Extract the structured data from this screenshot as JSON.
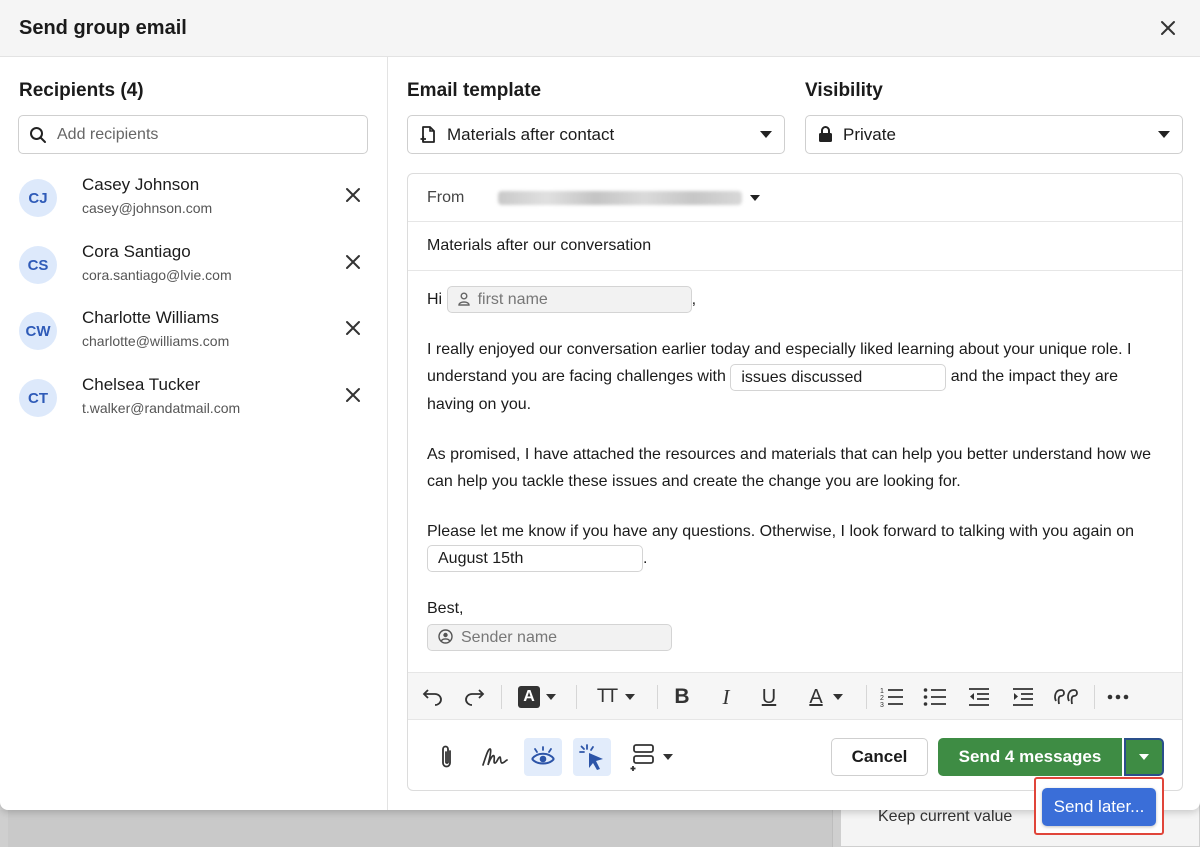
{
  "modal": {
    "title": "Send group email"
  },
  "recipients": {
    "title": "Recipients (4)",
    "search_placeholder": "Add recipients",
    "items": [
      {
        "initials": "CJ",
        "name": "Casey Johnson",
        "email": "casey@johnson.com"
      },
      {
        "initials": "CS",
        "name": "Cora Santiago",
        "email": "cora.santiago@lvie.com"
      },
      {
        "initials": "CW",
        "name": "Charlotte Williams",
        "email": "charlotte@williams.com"
      },
      {
        "initials": "CT",
        "name": "Chelsea Tucker",
        "email": "t.walker@randatmail.com"
      }
    ]
  },
  "template": {
    "title": "Email template",
    "selected": "Materials after contact"
  },
  "visibility": {
    "title": "Visibility",
    "selected": "Private"
  },
  "email": {
    "from_label": "From",
    "subject": "Materials after our conversation",
    "greeting": "Hi",
    "first_name_placeholder": "first name",
    "p1_before": "I really enjoyed our conversation earlier today and especially liked learning about your unique role. I understand you are facing challenges with",
    "issues_field": "issues discussed",
    "p1_after": "and the impact they are having on you.",
    "p2": "As promised, I have attached the resources and materials that can help you better understand how we can help you tackle these issues and create the change you are looking for.",
    "p3_before": "Please let me know if you have any questions. Otherwise, I look forward to talking with you again on",
    "date_field": "August 15th",
    "p3_after": ".",
    "signoff": "Best,",
    "sender_placeholder": "Sender name"
  },
  "toolbar": {
    "icons": [
      "undo-icon",
      "redo-icon",
      "text-highlight-icon",
      "text-size-icon",
      "bold-icon",
      "italic-icon",
      "underline-icon",
      "text-color-icon",
      "numbered-list-icon",
      "bullet-list-icon",
      "outdent-icon",
      "indent-icon",
      "quote-icon",
      "more-icon"
    ],
    "bold": "B",
    "italic": "I",
    "underline": "U",
    "color_letter": "A",
    "highlight_letter": "A",
    "size_letters": "TT"
  },
  "footer": {
    "cancel": "Cancel",
    "send": "Send 4 messages",
    "send_later": "Send later...",
    "icons": [
      "attachment-icon",
      "signature-icon",
      "track-opens-icon",
      "track-clicks-icon",
      "insert-field-icon"
    ]
  },
  "background": {
    "field_value": "Keep current value"
  },
  "colors": {
    "send_green": "#3e8c44",
    "send_later_blue": "#3a6ed8",
    "avatar_bg": "#dde9fb",
    "avatar_text": "#2f5bb8",
    "highlight_red": "#e0453a"
  }
}
